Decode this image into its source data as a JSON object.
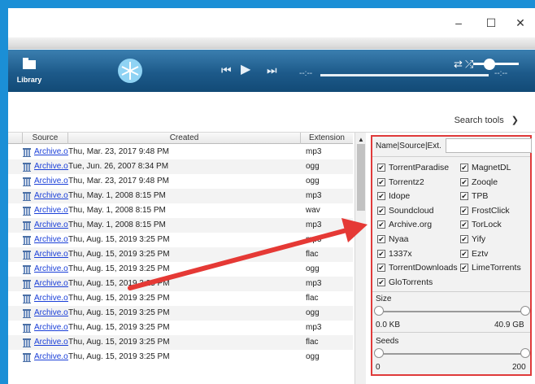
{
  "window": {
    "minimize": "–",
    "maximize": "☐",
    "close": "✕"
  },
  "player": {
    "library_label": "Library",
    "time_left": "--:--",
    "time_right": "--:--",
    "prev_symbol": "⏮",
    "play_symbol": "▶",
    "next_symbol": "⏭",
    "repeat_symbol": "⇄",
    "shuffle_symbol": "⤮"
  },
  "toolbar": {
    "search_tools_label": "Search tools",
    "search_tools_chevron": "❯"
  },
  "table": {
    "columns": [
      "Source",
      "Created",
      "Extension"
    ],
    "rows": [
      {
        "source": "Archive.org",
        "created": "Thu, Mar. 23, 2017 9:48 PM",
        "ext": "mp3"
      },
      {
        "source": "Archive.org",
        "created": "Tue, Jun. 26, 2007 8:34 PM",
        "ext": "ogg"
      },
      {
        "source": "Archive.org",
        "created": "Thu, Mar. 23, 2017 9:48 PM",
        "ext": "ogg"
      },
      {
        "source": "Archive.org",
        "created": "Thu, May. 1, 2008 8:15 PM",
        "ext": "mp3"
      },
      {
        "source": "Archive.org",
        "created": "Thu, May. 1, 2008 8:15 PM",
        "ext": "wav"
      },
      {
        "source": "Archive.org",
        "created": "Thu, May. 1, 2008 8:15 PM",
        "ext": "mp3"
      },
      {
        "source": "Archive.org",
        "created": "Thu, Aug. 15, 2019 3:25 PM",
        "ext": "mp3"
      },
      {
        "source": "Archive.org",
        "created": "Thu, Aug. 15, 2019 3:25 PM",
        "ext": "flac"
      },
      {
        "source": "Archive.org",
        "created": "Thu, Aug. 15, 2019 3:25 PM",
        "ext": "ogg"
      },
      {
        "source": "Archive.org",
        "created": "Thu, Aug. 15, 2019 3:25 PM",
        "ext": "mp3"
      },
      {
        "source": "Archive.org",
        "created": "Thu, Aug. 15, 2019 3:25 PM",
        "ext": "flac"
      },
      {
        "source": "Archive.org",
        "created": "Thu, Aug. 15, 2019 3:25 PM",
        "ext": "ogg"
      },
      {
        "source": "Archive.org",
        "created": "Thu, Aug. 15, 2019 3:25 PM",
        "ext": "mp3"
      },
      {
        "source": "Archive.org",
        "created": "Thu, Aug. 15, 2019 3:25 PM",
        "ext": "flac"
      },
      {
        "source": "Archive.org",
        "created": "Thu, Aug. 15, 2019 3:25 PM",
        "ext": "ogg"
      }
    ]
  },
  "filter": {
    "name_label": "Name|Source|Ext.",
    "name_value": "",
    "engines_left": [
      "TorrentParadise",
      "Torrentz2",
      "Idope",
      "Soundcloud",
      "Archive.org",
      "Nyaa",
      "1337x",
      "TorrentDownloads",
      "GloTorrents"
    ],
    "engines_right": [
      "MagnetDL",
      "Zooqle",
      "TPB",
      "FrostClick",
      "TorLock",
      "Yify",
      "Eztv",
      "LimeTorrents"
    ],
    "check_mark": "✔",
    "size_label": "Size",
    "size_min": "0.0 KB",
    "size_max": "40.9 GB",
    "seeds_label": "Seeds",
    "seeds_min": "0",
    "seeds_max": "200"
  },
  "colors": {
    "highlight": "#e03a3a",
    "player_bar": "#1d5a8a",
    "link": "#1a3fd8"
  }
}
